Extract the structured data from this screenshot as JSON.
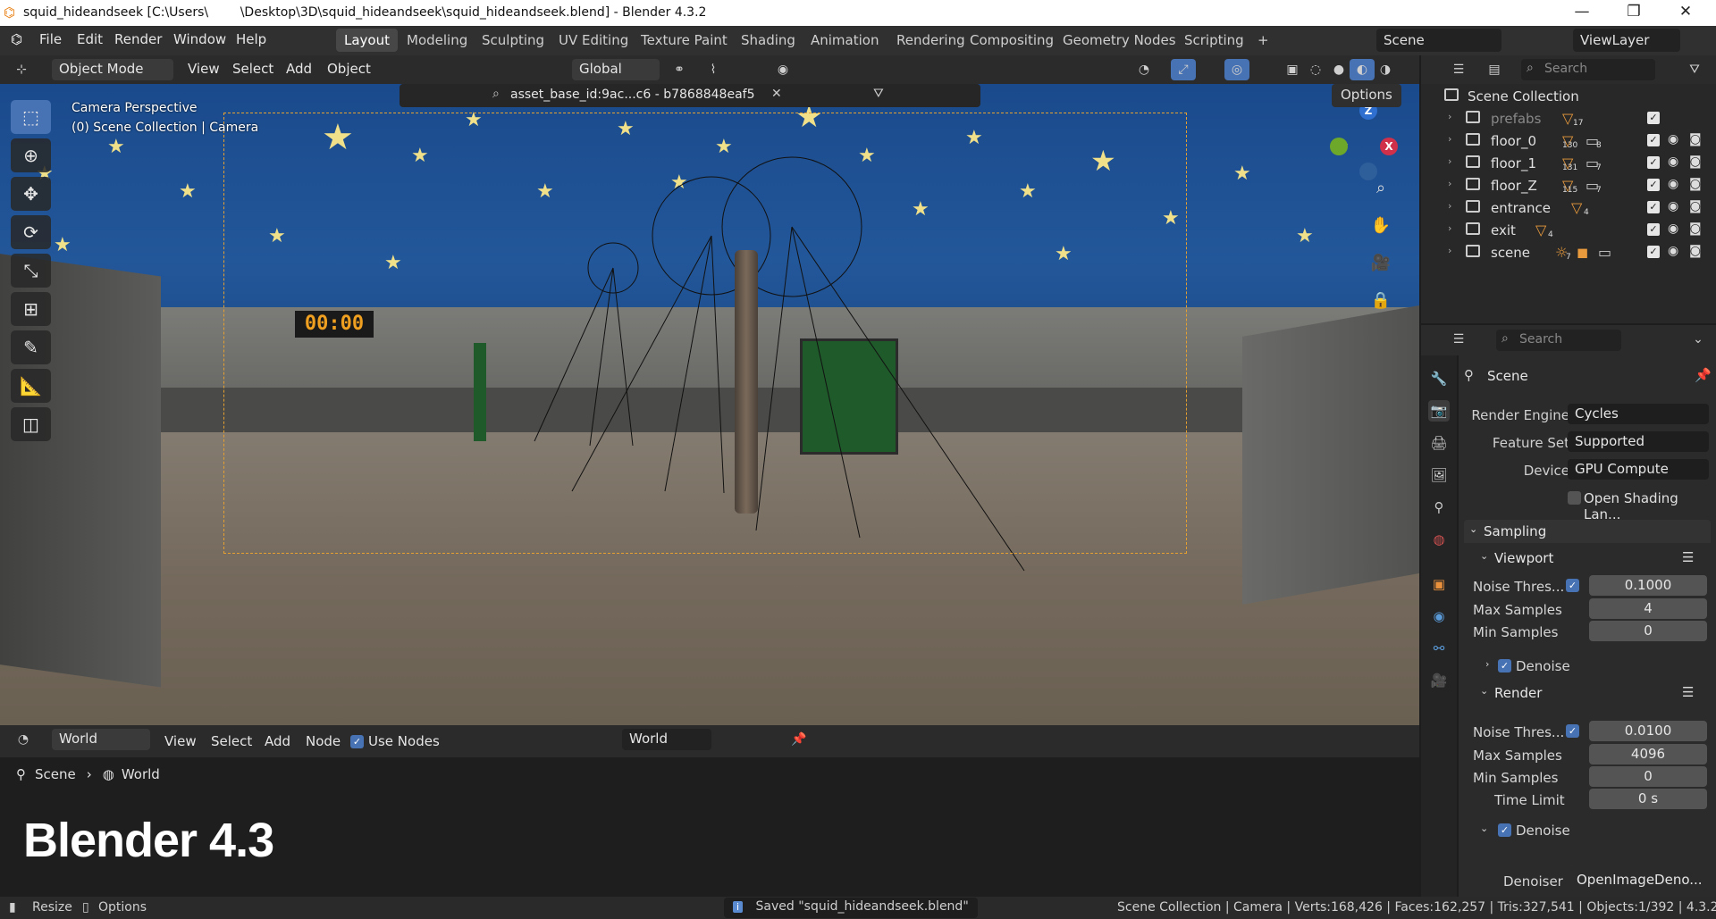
{
  "titlebar": {
    "title": "squid_hideandseek [C:\\Users\\        \\Desktop\\3D\\squid_hideandseek\\squid_hideandseek.blend] - Blender 4.3.2",
    "minimize": "—",
    "maximize": "❐",
    "close": "✕"
  },
  "menu": {
    "items": [
      "File",
      "Edit",
      "Render",
      "Window",
      "Help"
    ],
    "workspaces": [
      "Layout",
      "Modeling",
      "Sculpting",
      "UV Editing",
      "Texture Paint",
      "Shading",
      "Animation",
      "Rendering",
      "Compositing",
      "Geometry Nodes",
      "Scripting"
    ],
    "active_workspace": "Layout",
    "add_workspace": "+",
    "scene": "Scene",
    "view_layer": "ViewLayer"
  },
  "viewport_header": {
    "mode": "Object Mode",
    "menus": [
      "View",
      "Select",
      "Add",
      "Object"
    ],
    "transform_orientation": "Global",
    "asset_filter": "asset_base_id:9ac...c6 - b7868848eaf5",
    "options": "Options"
  },
  "viewport": {
    "overlay_line1": "Camera Perspective",
    "overlay_line2": "(0) Scene Collection | Camera",
    "timer_display": "00:00",
    "gizmo_z": "Z",
    "gizmo_x": "X"
  },
  "shader_header": {
    "type": "World",
    "menus": [
      "View",
      "Select",
      "Add",
      "Node"
    ],
    "use_nodes": "Use Nodes",
    "world_name": "World"
  },
  "breadcrumb": {
    "scene": "Scene",
    "world": "World"
  },
  "overlay_title": "Blender 4.3",
  "outliner": {
    "search_placeholder": "Search",
    "root": "Scene Collection",
    "rows": [
      {
        "name": "prefabs",
        "count": "17"
      },
      {
        "name": "floor_0",
        "count": "130",
        "count2": "8"
      },
      {
        "name": "floor_1",
        "count": "131",
        "count2": "7"
      },
      {
        "name": "floor_Z",
        "count": "115",
        "count2": "7"
      },
      {
        "name": "entrance",
        "count": "4"
      },
      {
        "name": "exit",
        "count": "4"
      },
      {
        "name": "scene",
        "count": "7"
      }
    ]
  },
  "properties": {
    "search_placeholder": "Search",
    "context": "Scene",
    "render_engine_label": "Render Engine",
    "render_engine": "Cycles",
    "feature_set_label": "Feature Set",
    "feature_set": "Supported",
    "device_label": "Device",
    "device": "GPU Compute",
    "osl": "Open Shading Lan...",
    "sampling": "Sampling",
    "viewport": "Viewport",
    "noise_label": "Noise Thres...",
    "vp_noise": "0.1000",
    "max_samples_label": "Max Samples",
    "vp_max_samples": "4",
    "min_samples_label": "Min Samples",
    "vp_min_samples": "0",
    "denoise": "Denoise",
    "render": "Render",
    "r_noise": "0.0100",
    "r_max_samples": "4096",
    "r_min_samples": "0",
    "time_limit_label": "Time Limit",
    "time_limit": "0 s",
    "denoiser_label": "Denoiser",
    "denoiser": "OpenImageDeno..."
  },
  "status": {
    "resize": "Resize",
    "options": "Options",
    "message": "Saved \"squid_hideandseek.blend\"",
    "collection": "Scene Collection",
    "object": "Camera",
    "verts": "Verts:168,426",
    "faces": "Faces:162,257",
    "tris": "Tris:327,541",
    "objects": "Objects:1/392",
    "version": "4.3.2"
  }
}
